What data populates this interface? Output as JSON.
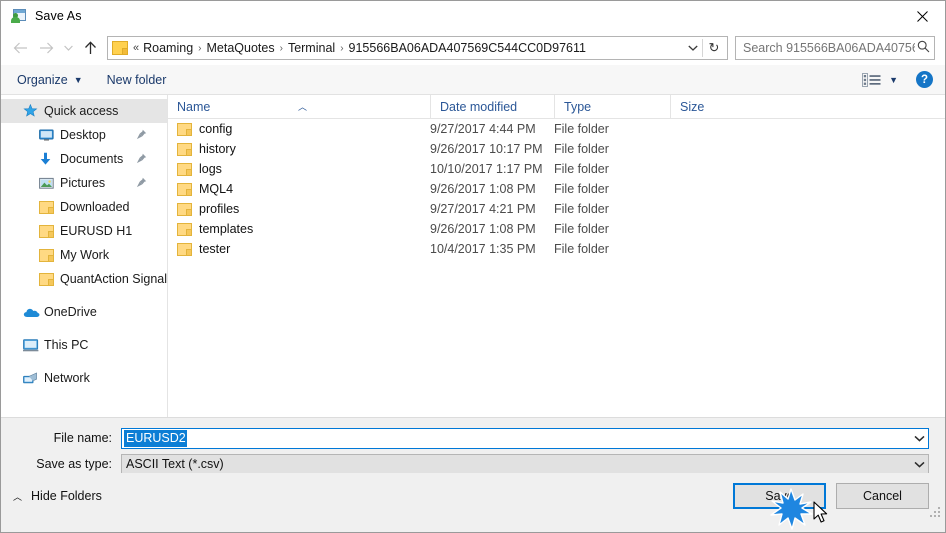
{
  "window": {
    "title": "Save As",
    "icon": "save-as-app-icon",
    "close_label": "✕"
  },
  "navigation": {
    "back_icon": "arrow-left-icon",
    "forward_icon": "arrow-right-icon",
    "recent_icon": "chevron-down-icon",
    "up_icon": "arrow-up-icon",
    "breadcrumb_prefix": "«",
    "breadcrumbs": [
      "Roaming",
      "MetaQuotes",
      "Terminal",
      "915566BA06ADA407569C544CC0D97611"
    ],
    "separator": "›",
    "dropdown_icon": "chevron-down-icon",
    "refresh_icon": "refresh-icon",
    "refresh_glyph": "↻"
  },
  "search": {
    "placeholder": "Search 915566BA06ADA40756...",
    "value": "",
    "icon": "search-icon"
  },
  "toolbar": {
    "organize_label": "Organize",
    "organize_caret": "▼",
    "new_folder_label": "New folder",
    "view_icon": "view-layout-icon",
    "view_caret": "▼",
    "help_label": "?",
    "help_icon": "help-icon"
  },
  "sidebar": {
    "items": [
      {
        "label": "Quick access",
        "icon": "star-icon",
        "level": 1,
        "selected": true,
        "pinned": false
      },
      {
        "label": "Desktop",
        "icon": "desktop-icon",
        "level": 2,
        "selected": false,
        "pinned": true
      },
      {
        "label": "Documents",
        "icon": "documents-download-icon",
        "level": 2,
        "selected": false,
        "pinned": true
      },
      {
        "label": "Pictures",
        "icon": "pictures-icon",
        "level": 2,
        "selected": false,
        "pinned": true
      },
      {
        "label": "Downloaded",
        "icon": "folder-icon",
        "level": 2,
        "selected": false,
        "pinned": false
      },
      {
        "label": "EURUSD H1",
        "icon": "folder-icon",
        "level": 2,
        "selected": false,
        "pinned": false
      },
      {
        "label": "My Work",
        "icon": "folder-icon",
        "level": 2,
        "selected": false,
        "pinned": false
      },
      {
        "label": "QuantAction Signal",
        "icon": "folder-icon",
        "level": 2,
        "selected": false,
        "pinned": false
      },
      {
        "label": "OneDrive",
        "icon": "onedrive-cloud-icon",
        "level": 1,
        "selected": false,
        "pinned": false,
        "gap_before": true
      },
      {
        "label": "This PC",
        "icon": "this-pc-icon",
        "level": 1,
        "selected": false,
        "pinned": false,
        "gap_before": true
      },
      {
        "label": "Network",
        "icon": "network-icon",
        "level": 1,
        "selected": false,
        "pinned": false,
        "gap_before": true
      }
    ],
    "pin_icon": "pin-icon"
  },
  "filelist": {
    "columns": [
      "Name",
      "Date modified",
      "Type",
      "Size"
    ],
    "sort_caret": "︿",
    "rows": [
      {
        "name": "config",
        "date": "9/27/2017 4:44 PM",
        "type": "File folder",
        "size": "",
        "icon": "folder-icon"
      },
      {
        "name": "history",
        "date": "9/26/2017 10:17 PM",
        "type": "File folder",
        "size": "",
        "icon": "folder-icon"
      },
      {
        "name": "logs",
        "date": "10/10/2017 1:17 PM",
        "type": "File folder",
        "size": "",
        "icon": "folder-icon"
      },
      {
        "name": "MQL4",
        "date": "9/26/2017 1:08 PM",
        "type": "File folder",
        "size": "",
        "icon": "folder-icon"
      },
      {
        "name": "profiles",
        "date": "9/27/2017 4:21 PM",
        "type": "File folder",
        "size": "",
        "icon": "folder-icon"
      },
      {
        "name": "templates",
        "date": "9/26/2017 1:08 PM",
        "type": "File folder",
        "size": "",
        "icon": "folder-icon"
      },
      {
        "name": "tester",
        "date": "10/4/2017 1:35 PM",
        "type": "File folder",
        "size": "",
        "icon": "folder-icon"
      }
    ]
  },
  "form": {
    "filename_label": "File name:",
    "filename_value": "EURUSD2",
    "filetype_label": "Save as type:",
    "filetype_value": "ASCII Text (*.csv)",
    "chevron": "⌄"
  },
  "footer": {
    "hide_folders_label": "Hide Folders",
    "hide_folders_caret": "︿",
    "save_label": "Save",
    "cancel_label": "Cancel",
    "resize_grip_icon": "resize-grip-icon"
  },
  "colors": {
    "accent": "#0078d7",
    "selection": "#0c7ed5",
    "crumb_text": "#1a1a1a",
    "toolbar_text": "#1b3a6b",
    "column_header": "#2b5797",
    "folder_yellow": "#ffd14f",
    "help_blue": "#1575c6"
  }
}
